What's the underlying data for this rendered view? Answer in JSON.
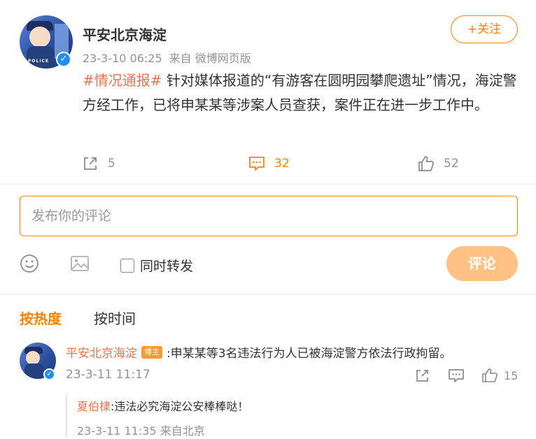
{
  "post": {
    "username": "平安北京海淀",
    "timestamp": "23-3-10 06:25",
    "source": "来自 微博网页版",
    "follow_label": "+关注",
    "hashtag": "#情况通报#",
    "text": " 针对媒体报道的“有游客在圆明园攀爬遗址”情况，海淀警方经工作，已将申某某等涉案人员查获，案件正在进一步工作中。",
    "reposts": "5",
    "comments": "32",
    "likes": "52",
    "avatar_badge_text": "POLICE"
  },
  "composer": {
    "placeholder": "发布你的评论",
    "repost_label": "同时转发",
    "submit_label": "评论"
  },
  "sort_tabs": {
    "hot": "按热度",
    "time": "按时间"
  },
  "comment": {
    "username": "平安北京海淀",
    "badge": "博主",
    "text": ":申某某等3名违法行为人已被海淀警方依法行政拘留。",
    "timestamp": "23-3-11 11:17",
    "likes": "15"
  },
  "reply": {
    "username": "夏伯棣",
    "text": ":违法必究海淀公安棒棒哒！",
    "meta": "23-3-11 11:35 来自北京"
  },
  "colors": {
    "accent": "#ff8200",
    "link": "#eb7350",
    "muted": "#939393",
    "verified": "#1e8ef0"
  }
}
